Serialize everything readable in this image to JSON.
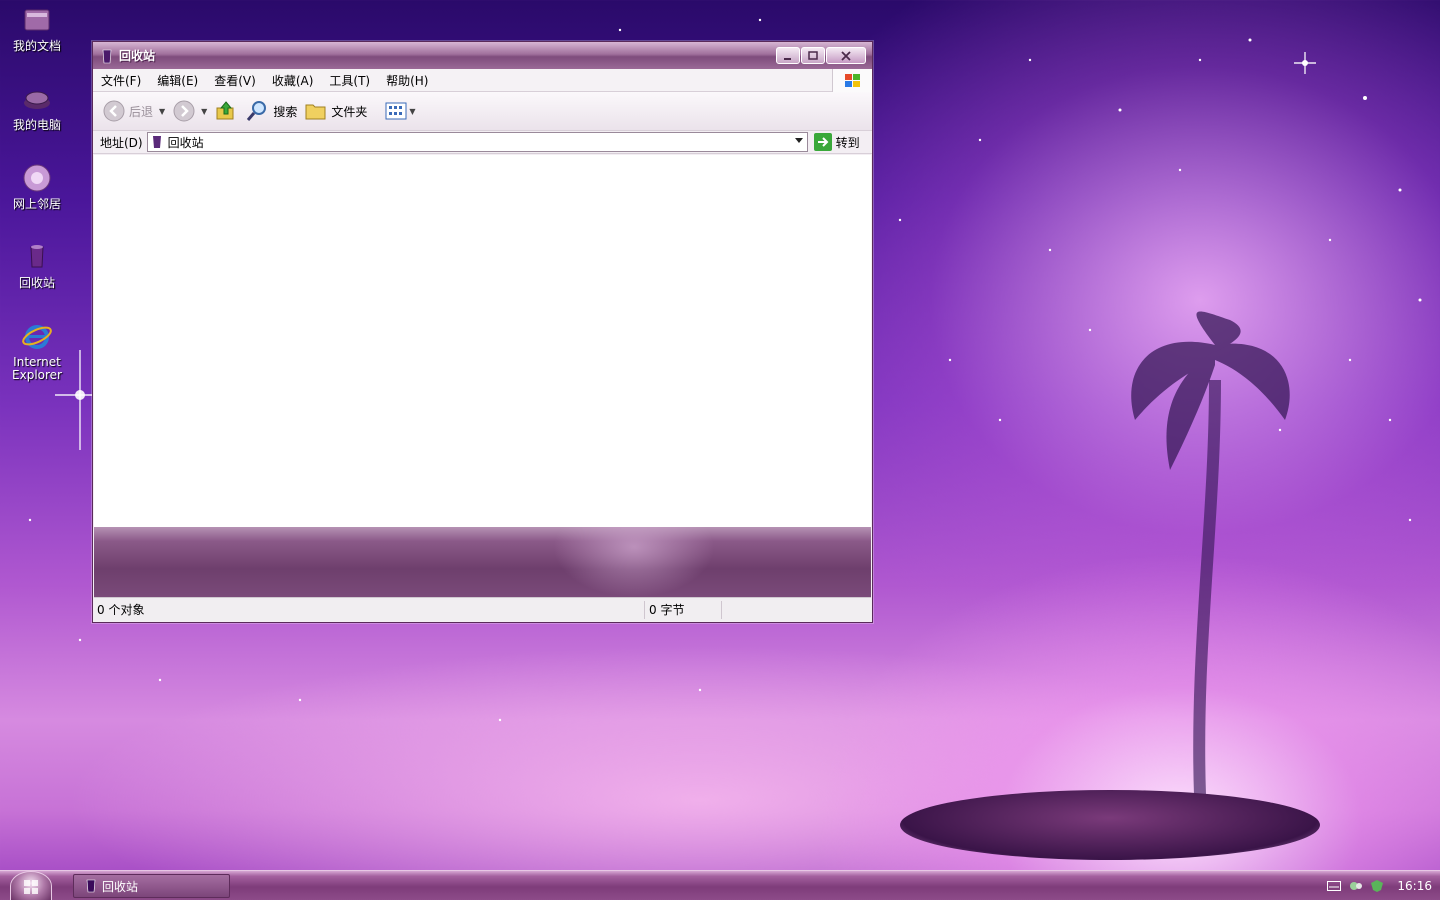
{
  "desktop": {
    "icons": [
      {
        "label": "我的文档"
      },
      {
        "label": "我的电脑"
      },
      {
        "label": "网上邻居"
      },
      {
        "label": "回收站"
      },
      {
        "label": "Internet Explorer"
      }
    ]
  },
  "window": {
    "title": "回收站",
    "menu": {
      "file": "文件(F)",
      "edit": "编辑(E)",
      "view": "查看(V)",
      "favorites": "收藏(A)",
      "tools": "工具(T)",
      "help": "帮助(H)"
    },
    "toolbar": {
      "back": "后退",
      "search": "搜索",
      "folders": "文件夹"
    },
    "address": {
      "label": "地址(D)",
      "value": "回收站",
      "go": "转到"
    },
    "status": {
      "objects": "0 个对象",
      "size": "0 字节"
    }
  },
  "taskbar": {
    "task_label": "回收站",
    "clock": "16:16"
  },
  "colors": {
    "accent": "#8b5a89",
    "titlebar": "#a0709c",
    "taskbar": "#7e3c7a"
  }
}
